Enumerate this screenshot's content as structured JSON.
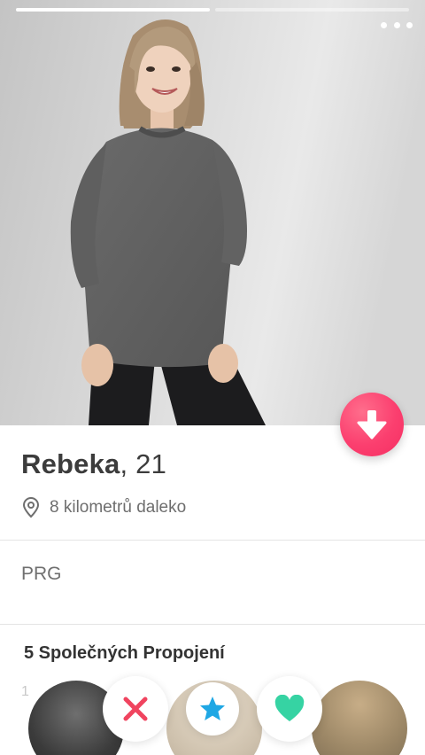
{
  "profile": {
    "name": "Rebeka",
    "age_text": ", 21",
    "distance": "8 kilometrů daleko",
    "bio": "PRG"
  },
  "photos": {
    "count": 2,
    "active_index": 0
  },
  "connections": {
    "title": "5 Společných Propojení",
    "partial_letter": "1"
  },
  "icons": {
    "menu": "more-horizontal-icon",
    "collapse": "arrow-down-icon",
    "location": "location-pin-icon",
    "nope": "x-icon",
    "super_like": "star-icon",
    "like": "heart-icon"
  },
  "colors": {
    "collapse_button": "#fb3f6f",
    "nope": "#f0445f",
    "super_like": "#1fa7e4",
    "like": "#36d3a3"
  }
}
